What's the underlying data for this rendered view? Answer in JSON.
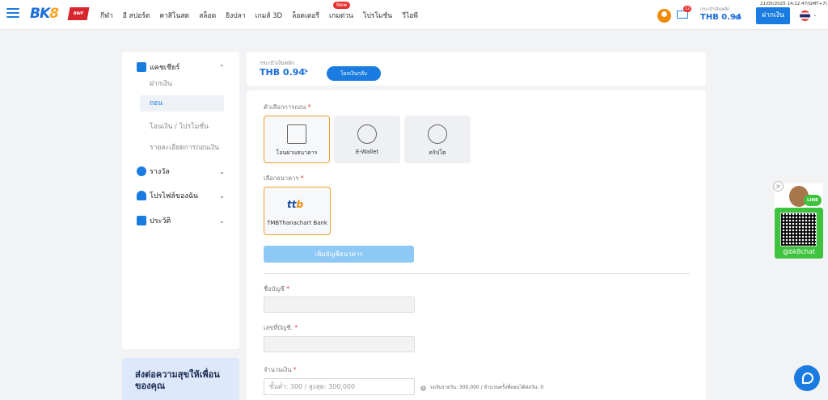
{
  "header": {
    "logo_main": "BK",
    "logo_num": "8",
    "bwf_logo": "BWF",
    "nav": [
      "กีฬา",
      "อี สปอร์ต",
      "คาสิโนสด",
      "สล็อต",
      "ยิงปลา",
      "เกมส์ 3D",
      "ล็อตเตอรี่",
      "เกมด่วน",
      "โปรโมชั่น",
      "วีไอพี"
    ],
    "new_badge": "New",
    "mail_count": "12",
    "balance_label": "กระเป๋าเงินหลัก",
    "balance_value": "THB 0.94",
    "datetime": "21/05/2025 14:12:47(GMT+7)",
    "deposit_label": "ฝากเงิน"
  },
  "sidebar": {
    "cashier": "แคชเชียร์",
    "sub_deposit": "ฝากเงิน",
    "sub_withdraw": "ถอน",
    "sub_transfer": "โอนเงิน / โปรโมชั่น",
    "sub_history": "รายละเอียดการถอนเงิน",
    "rewards": "รางวัล",
    "profile": "โปรไฟล์ของฉัน",
    "history": "ประวัติ",
    "promo_text": "ส่งต่อความสุขให้เพื่อนของคุณ"
  },
  "wallet": {
    "label": "กระเป๋าเงินหลัก",
    "value": "THB 0.94",
    "transfer_btn": "โยกเงินกลับ"
  },
  "form": {
    "method_label": "ตัวเลือกการถอน",
    "methods": [
      "โอนผ่านธนาคาร",
      "E-Wallet",
      "คริปโต"
    ],
    "bank_label": "เลือกธนาคาร",
    "bank_name": "TMBThanachart Bank",
    "bank_logo_a": "tt",
    "bank_logo_b": "b",
    "add_bank_btn": "เพิ่มบัญชีธนาคาร",
    "account_name_label": "ชื่อบัญชี",
    "account_no_label": "เลขที่บัญชี.",
    "amount_label": "จำนวนเงิน",
    "amount_placeholder": "ขั้นต่ำ: 300 / สูงสุด: 300,000",
    "limit_note": "วงเงินรายวัน: 300,000 / จำนวนครั้งที่ถอนได้ต่อวัน: 0",
    "required_mark": "*"
  },
  "line_widget": {
    "badge": "LINE",
    "handle": "@bk8chat",
    "close": "×"
  },
  "colors": {
    "primary": "#1a7ce0",
    "selected_border": "#f0a030",
    "line_green": "#3ec33e"
  }
}
